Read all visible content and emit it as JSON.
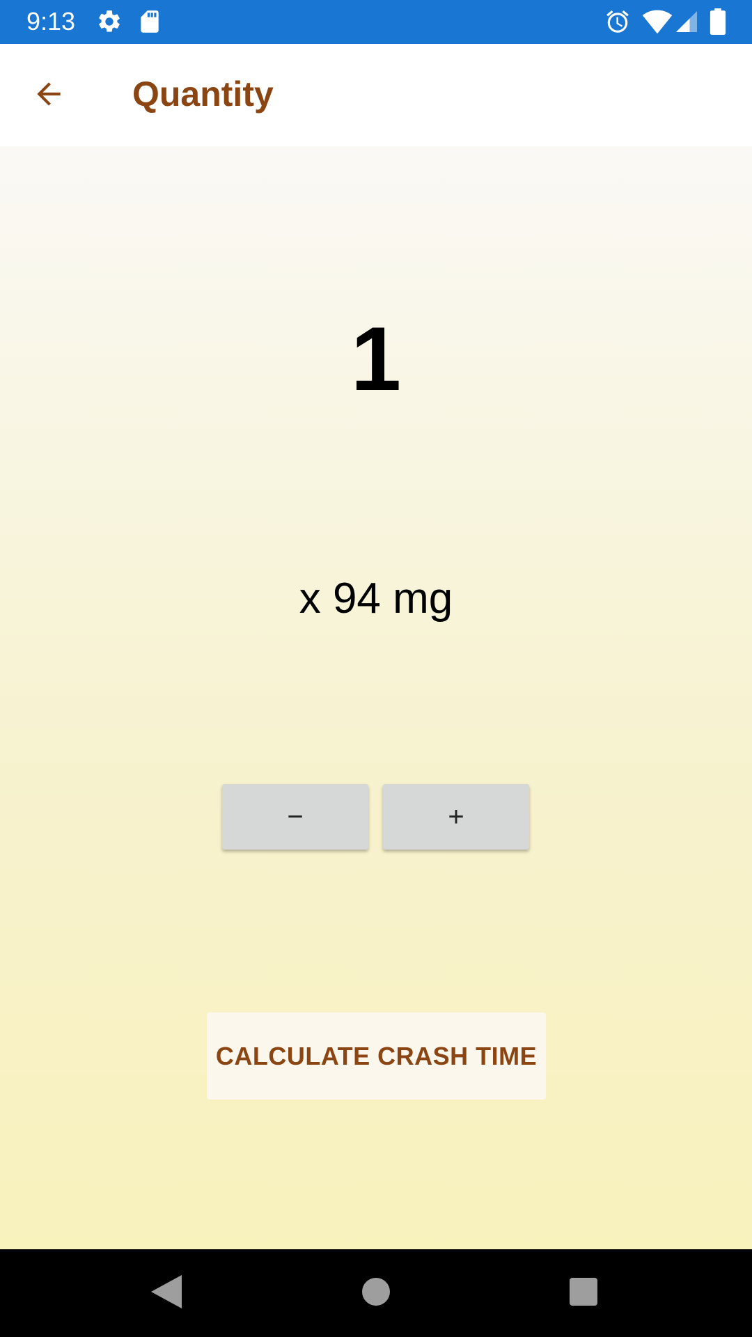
{
  "status_bar": {
    "time": "9:13",
    "icons": [
      "settings-icon",
      "sd-card-icon",
      "alarm-icon",
      "wifi-icon",
      "signal-icon",
      "battery-icon"
    ]
  },
  "app_bar": {
    "title": "Quantity",
    "back_icon": "arrow-back-icon"
  },
  "quantity": {
    "value": "1",
    "unit_label": "x 94 mg",
    "minus_label": "−",
    "plus_label": "+"
  },
  "actions": {
    "calculate_label": "CALCULATE CRASH TIME"
  },
  "nav_bar": {
    "buttons": [
      "back-triangle-icon",
      "home-circle-icon",
      "recents-square-icon"
    ]
  },
  "colors": {
    "status_bar": "#1976d2",
    "accent": "#8b4513",
    "stepper_bg": "#d6d7d7",
    "calc_bg": "#fbf7ec",
    "nav_bar": "#000000"
  }
}
